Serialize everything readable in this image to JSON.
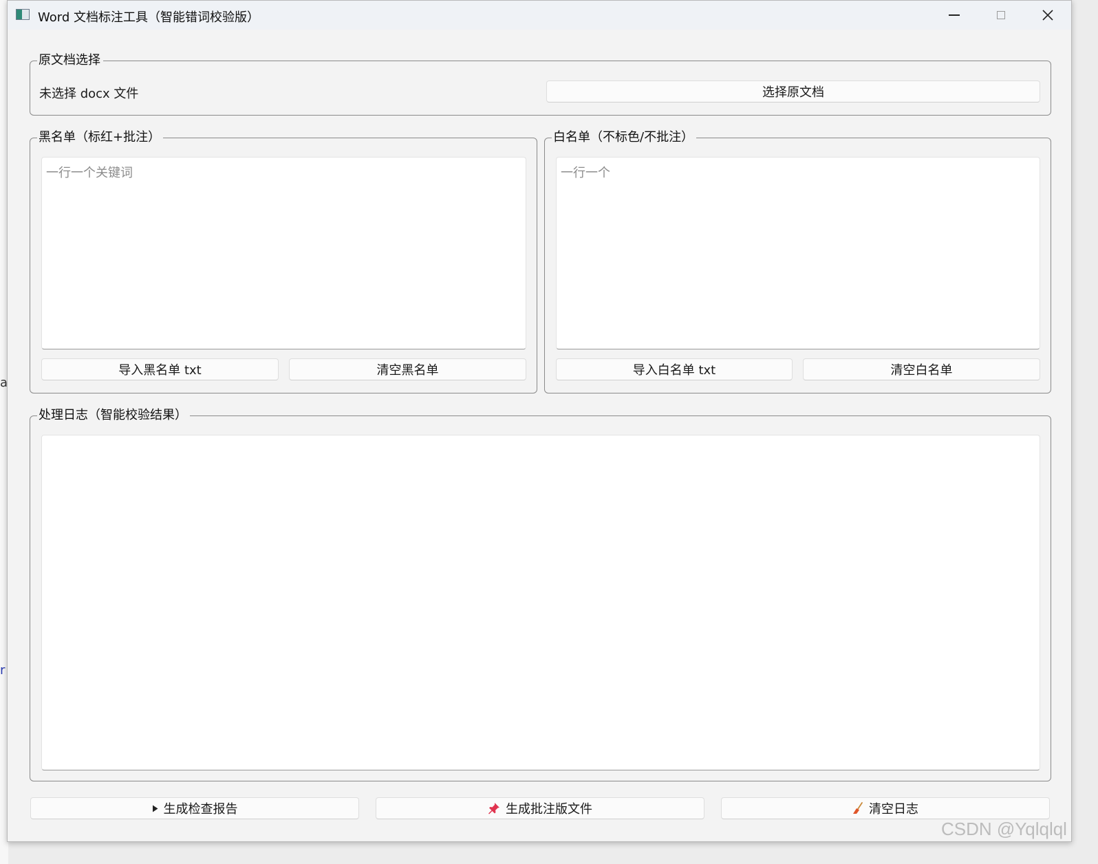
{
  "window": {
    "title": "Word 文档标注工具（智能错词校验版）"
  },
  "source_group": {
    "title": "原文档选择",
    "status": "未选择 docx 文件",
    "select_button": "选择原文档"
  },
  "blacklist_group": {
    "title": "黑名单（标红+批注）",
    "placeholder": "一行一个关键词",
    "import_button": "导入黑名单 txt",
    "clear_button": "清空黑名单"
  },
  "whitelist_group": {
    "title": "白名单（不标色/不批注）",
    "placeholder": "一行一个",
    "import_button": "导入白名单 txt",
    "clear_button": "清空白名单"
  },
  "log_group": {
    "title": "处理日志（智能校验结果）",
    "content": ""
  },
  "actions": {
    "report_button": "生成检查报告",
    "annotate_button": "生成批注版文件",
    "clear_log_button": "清空日志"
  },
  "icons": {
    "report": "play-triangle-icon",
    "annotate": "pushpin-icon",
    "clear_log": "broom-icon",
    "pushpin_color": "#e0334f",
    "broom_color": "#e0562a"
  },
  "background_fragments": [
    "at",
    "r"
  ],
  "watermark": "CSDN @Yqlqlql"
}
